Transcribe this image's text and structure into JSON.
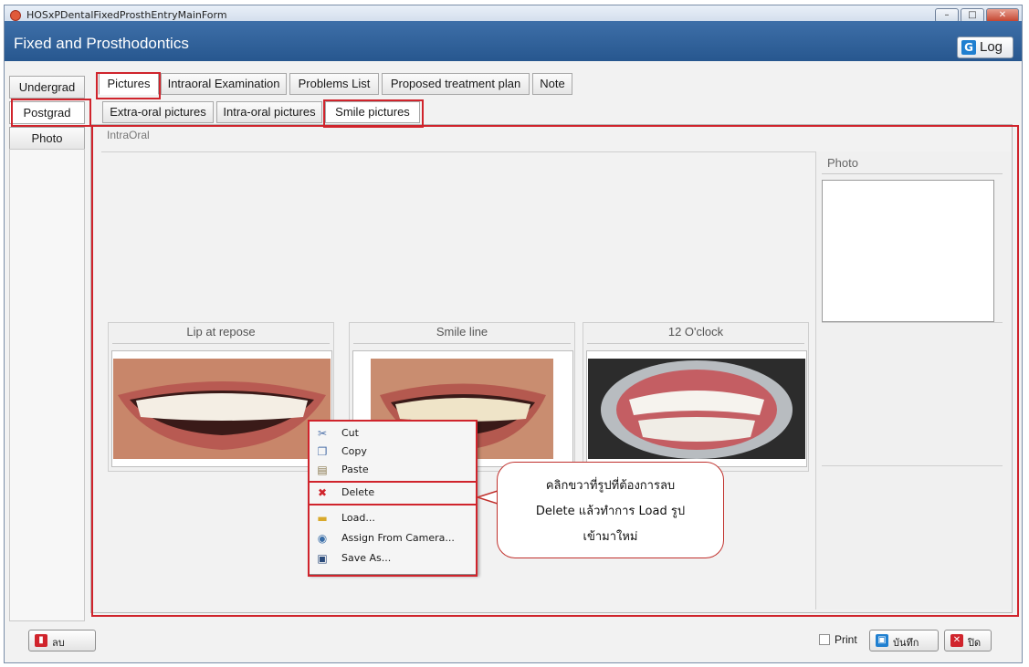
{
  "window": {
    "title": "HOSxPDentalFixedProsthEntryMainForm"
  },
  "header": {
    "title": "Fixed and Prosthodontics",
    "log_label": "Log"
  },
  "side_tabs": [
    {
      "label": "Undergrad"
    },
    {
      "label": "Postgrad"
    },
    {
      "label": "Photo"
    }
  ],
  "tabs": [
    {
      "label": "Pictures"
    },
    {
      "label": "Intraoral Examination"
    },
    {
      "label": "Problems List"
    },
    {
      "label": "Proposed treatment plan"
    },
    {
      "label": "Note"
    }
  ],
  "subtabs": [
    {
      "label": "Extra-oral pictures"
    },
    {
      "label": "Intra-oral pictures"
    },
    {
      "label": "Smile pictures"
    }
  ],
  "section": {
    "label": "IntraOral"
  },
  "photos": [
    {
      "caption": "Lip at repose"
    },
    {
      "caption": "Smile line"
    },
    {
      "caption": "12 O'clock"
    }
  ],
  "right_panel": {
    "title": "Photo"
  },
  "context_menu": {
    "items": [
      {
        "label": "Cut",
        "icon": "scissors-icon"
      },
      {
        "label": "Copy",
        "icon": "copy-icon"
      },
      {
        "label": "Paste",
        "icon": "paste-icon"
      },
      {
        "label": "Delete",
        "icon": "delete-icon"
      },
      {
        "label": "Load...",
        "icon": "folder-icon"
      },
      {
        "label": "Assign From Camera...",
        "icon": "camera-icon"
      },
      {
        "label": "Save As...",
        "icon": "save-icon"
      }
    ]
  },
  "callout": {
    "lines": [
      "คลิกขวาที่รูปที่ต้องการลบ",
      "Delete แล้วทำการ Load รูป",
      "เข้ามาใหม่"
    ]
  },
  "footer": {
    "delete_label": "ลบ",
    "print_label": "Print",
    "save_label": "บันทึก",
    "close_label": "ปิด"
  },
  "colors": {
    "header": "#2f62a0",
    "highlight": "#d0242c",
    "delete_icon": "#d0242c",
    "save_icon": "#1f7fd0"
  }
}
